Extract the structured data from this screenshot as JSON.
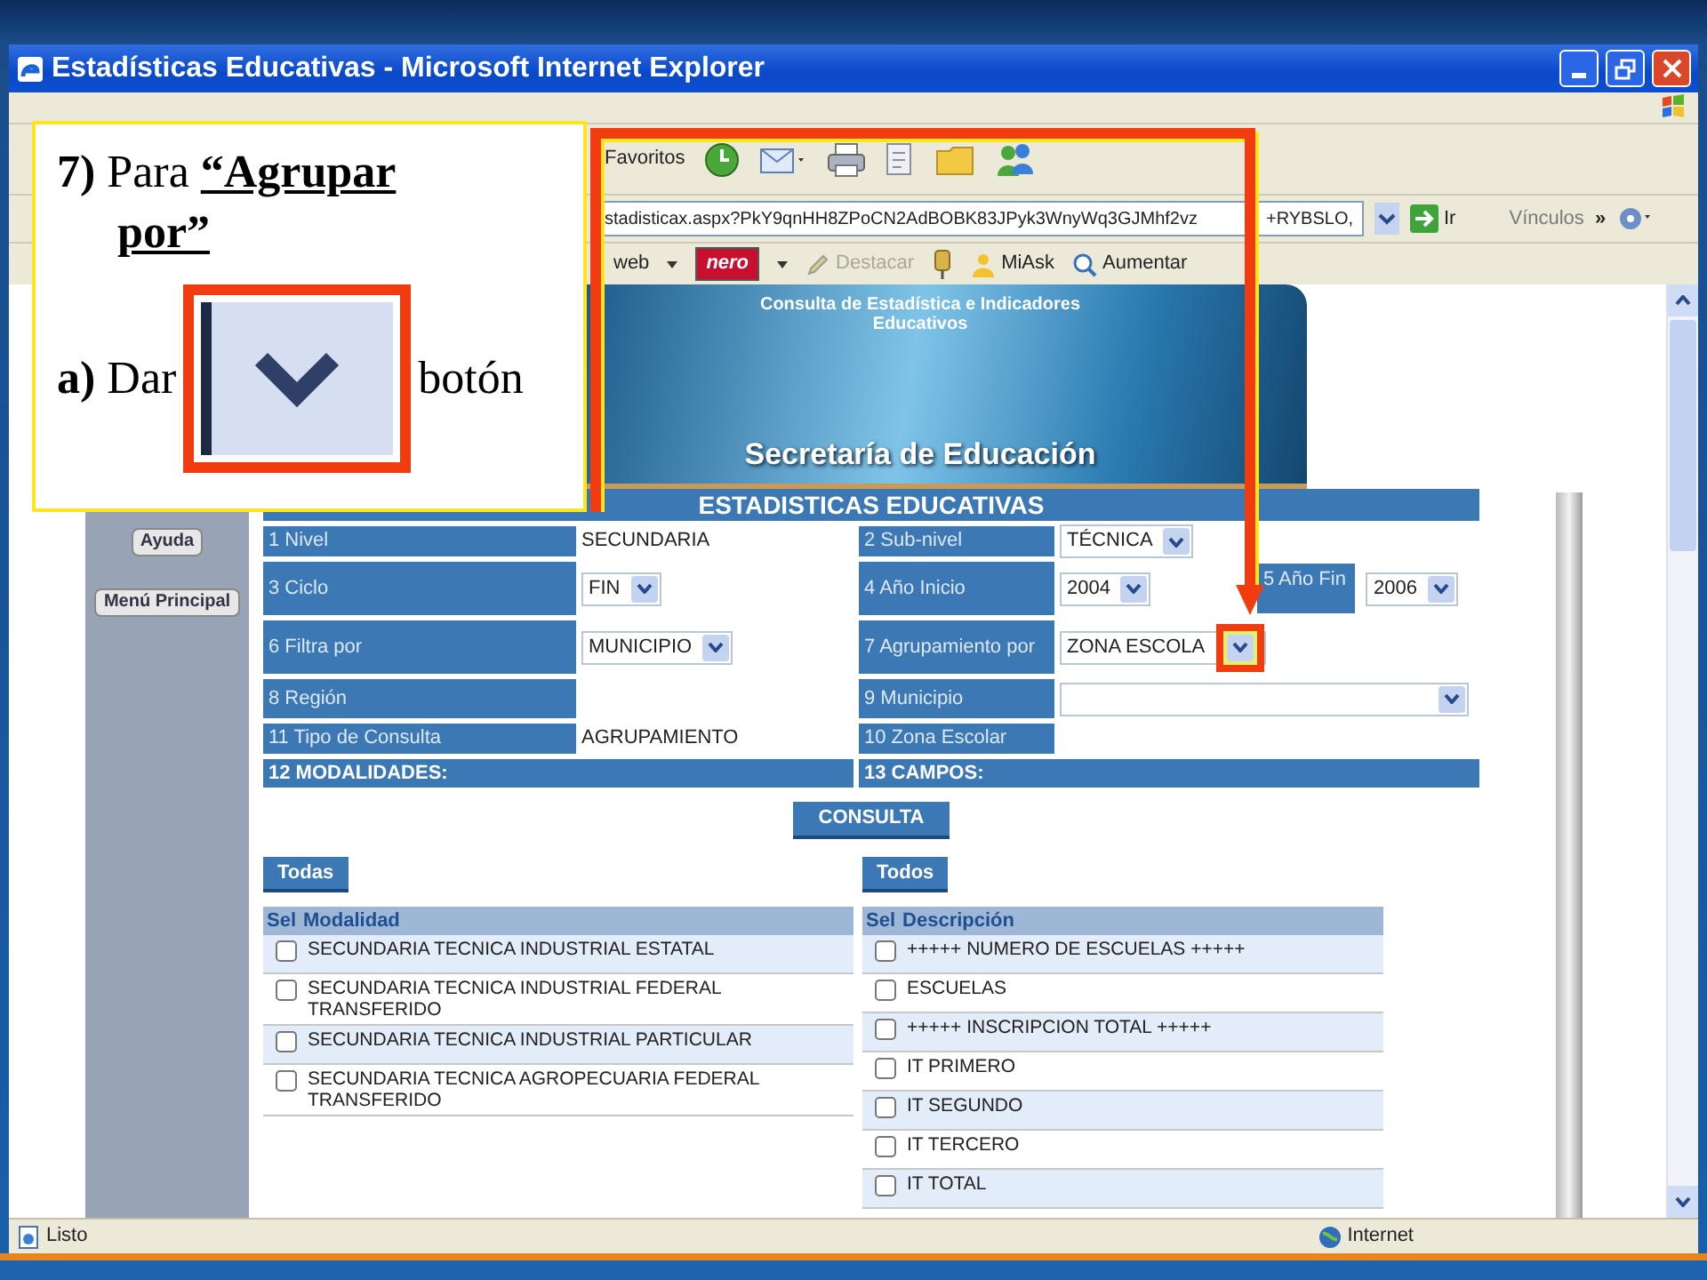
{
  "window": {
    "title": "Estadísticas Educativas - Microsoft Internet Explorer"
  },
  "toolbar": {
    "favorites_label": "Favoritos"
  },
  "address_bar": {
    "url": [
      "stadisticax.aspx?PkY9qnHH8ZPoCN2AdBOBK83JPyk3WnyWq3GJMhf2vz",
      "+RYBSLO,"
    ],
    "go_label": "Ir",
    "links_label": "Vínculos",
    "more": "»"
  },
  "links_bar": [
    {
      "kind": "menu",
      "label": "web",
      "disabled": false
    },
    {
      "kind": "logo",
      "label": "nero"
    },
    {
      "kind": "pencil",
      "label": "Destacar",
      "disabled": true
    },
    {
      "kind": "person",
      "label": "MiAsk",
      "disabled": false
    },
    {
      "kind": "zoom",
      "label": "Aumentar",
      "disabled": false
    }
  ],
  "banner": {
    "title": "Consulta de Estadística e Indicadores Educativos",
    "agency": "Secretaría de Educación"
  },
  "sidebar": {
    "buttons": [
      "Ayuda",
      "Menú Principal"
    ]
  },
  "form": {
    "title": "ESTADISTICAS EDUCATIVAS",
    "rows": [
      {
        "cells": [
          {
            "kind": "label",
            "text": "1 Nivel"
          },
          {
            "kind": "text",
            "text": "SECUNDARIA"
          },
          {
            "kind": "label",
            "text": "2 Sub-nivel"
          },
          {
            "kind": "select",
            "value": "TÉCNICA",
            "highlighted": false
          }
        ]
      },
      {
        "cells": [
          {
            "kind": "label",
            "text": "3 Ciclo"
          },
          {
            "kind": "select",
            "value": "FIN",
            "highlighted": false
          },
          {
            "kind": "label",
            "text": "4 Año Inicio"
          },
          {
            "kind": "group",
            "items": [
              {
                "kind": "select",
                "value": "2004",
                "highlighted": false
              },
              {
                "kind": "label",
                "text": "5 Año Fin"
              },
              {
                "kind": "select",
                "value": "2006",
                "highlighted": false
              }
            ]
          }
        ]
      },
      {
        "cells": [
          {
            "kind": "label",
            "text": "6 Filtra por"
          },
          {
            "kind": "select",
            "value": "MUNICIPIO",
            "highlighted": false
          },
          {
            "kind": "label",
            "text": "7 Agrupamiento por"
          },
          {
            "kind": "select",
            "value": "ZONA ESCOLA",
            "highlighted": true
          }
        ]
      },
      {
        "cells": [
          {
            "kind": "label",
            "text": "8 Región"
          },
          {
            "kind": "blank"
          },
          {
            "kind": "label",
            "text": "9 Municipio"
          },
          {
            "kind": "wideselect",
            "highlighted": false
          }
        ]
      },
      {
        "cells": [
          {
            "kind": "label",
            "text": "11 Tipo de Consulta"
          },
          {
            "kind": "text",
            "text": "AGRUPAMIENTO"
          },
          {
            "kind": "label",
            "text": "10 Zona Escolar"
          },
          {
            "kind": "blank"
          }
        ]
      },
      {
        "cells": [
          {
            "kind": "heading",
            "text": "12 MODALIDADES:",
            "colspan": 2
          },
          {
            "kind": "heading",
            "text": "13 CAMPOS:",
            "colspan": 2
          }
        ]
      }
    ]
  },
  "submit": "CONSULTA",
  "modalities": {
    "select_all": "Todas",
    "columns": [
      "Sel",
      "Modalidad"
    ],
    "items": [
      {
        "text": "SECUNDARIA TECNICA INDUSTRIAL ESTATAL",
        "checked": false
      },
      {
        "text": "SECUNDARIA TECNICA INDUSTRIAL FEDERAL TRANSFERIDO",
        "checked": false
      },
      {
        "text": "SECUNDARIA TECNICA INDUSTRIAL PARTICULAR",
        "checked": false
      },
      {
        "text": "SECUNDARIA TECNICA AGROPECUARIA FEDERAL TRANSFERIDO",
        "checked": false
      }
    ]
  },
  "fields": {
    "select_all": "Todos",
    "columns": [
      "Sel",
      "Descripción"
    ],
    "items": [
      {
        "text": "+++++ NUMERO DE ESCUELAS +++++",
        "checked": false
      },
      {
        "text": "ESCUELAS",
        "checked": false
      },
      {
        "text": "+++++ INSCRIPCION TOTAL +++++",
        "checked": false
      },
      {
        "text": "IT PRIMERO",
        "checked": false
      },
      {
        "text": "IT SEGUNDO",
        "checked": false
      },
      {
        "text": "IT TERCERO",
        "checked": false
      },
      {
        "text": "IT TOTAL",
        "checked": false
      }
    ]
  },
  "status_bar": {
    "text": "Listo",
    "zone": "Internet"
  },
  "callout": {
    "heading": "**7)** Para **“Agrupar por”**",
    "step": "**a)** Dar",
    "step_end": "botón"
  }
}
